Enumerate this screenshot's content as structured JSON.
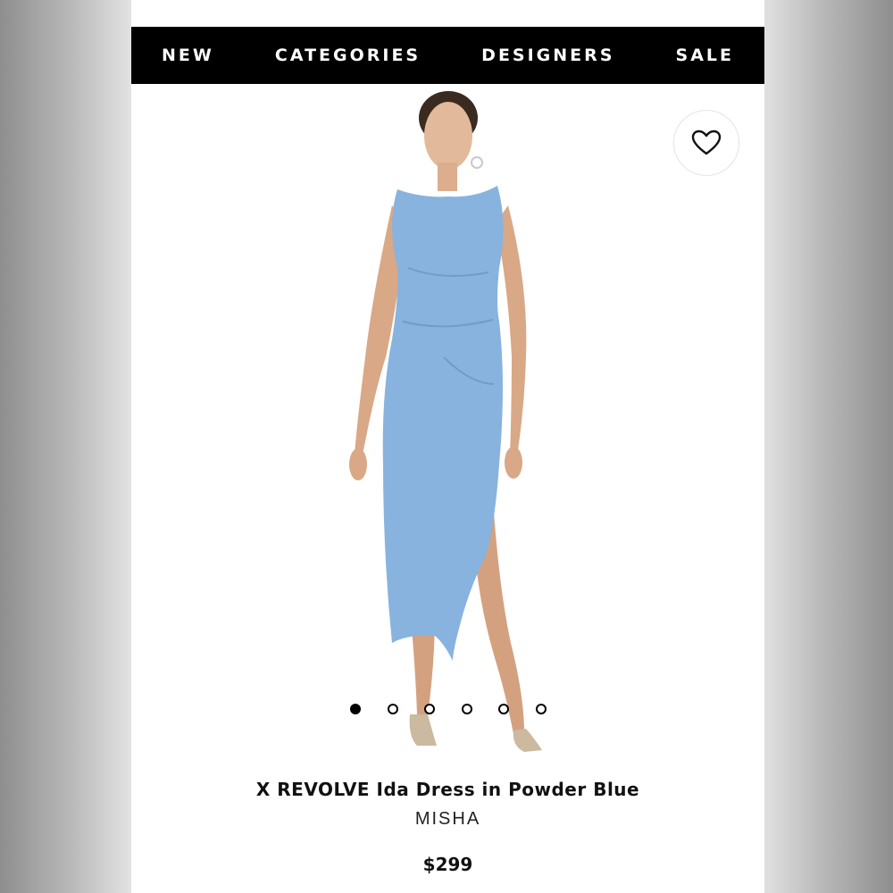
{
  "nav": {
    "items": [
      {
        "label": "NEW"
      },
      {
        "label": "CATEGORIES"
      },
      {
        "label": "DESIGNERS"
      },
      {
        "label": "SALE"
      }
    ]
  },
  "product": {
    "title": "X REVOLVE Ida Dress in Powder Blue",
    "brand": "MISHA",
    "price": "$299",
    "dress_color": "#87b3de"
  },
  "gallery": {
    "image_count": 6,
    "active_index": 0
  },
  "favorite": {
    "icon": "heart-icon"
  }
}
